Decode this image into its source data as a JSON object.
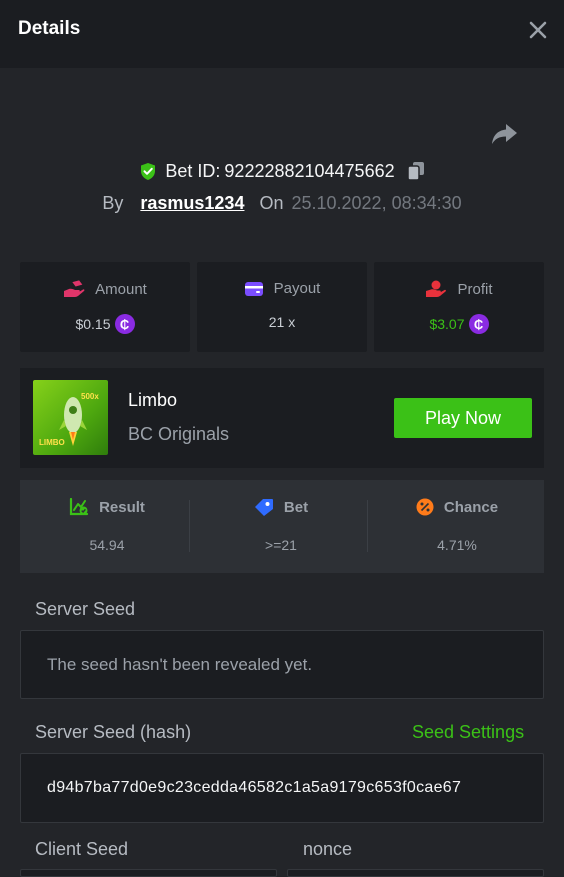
{
  "header": {
    "title": "Details"
  },
  "bet": {
    "id_label": "Bet ID:",
    "id": "92222882104475662",
    "by_label": "By",
    "username": "rasmus1234",
    "on_label": "On",
    "datetime": "25.10.2022, 08:34:30"
  },
  "stats": {
    "amount": {
      "label": "Amount",
      "value": "$0.15"
    },
    "payout": {
      "label": "Payout",
      "value": "21 x"
    },
    "profit": {
      "label": "Profit",
      "value": "$3.07"
    }
  },
  "game": {
    "name": "Limbo",
    "provider": "BC Originals",
    "thumb_text": "LIMBO",
    "thumb_badge": "500x",
    "play_label": "Play Now"
  },
  "result": {
    "result": {
      "label": "Result",
      "value": "54.94"
    },
    "bet": {
      "label": "Bet",
      "value": ">=21"
    },
    "chance": {
      "label": "Chance",
      "value": "4.71%"
    }
  },
  "server_seed": {
    "label": "Server Seed",
    "value": "The seed hasn't been revealed yet."
  },
  "server_seed_hash": {
    "label": "Server Seed (hash)",
    "settings_label": "Seed Settings",
    "value": "d94b7ba77d0e9c23cedda46582c1a5a9179c653f0cae67"
  },
  "client_seed": {
    "label": "Client Seed"
  },
  "nonce": {
    "label": "nonce"
  },
  "colors": {
    "accent_green": "#3bc117",
    "coin_purple": "#8a2be2",
    "amount_icon": "#e0356a",
    "payout_icon": "#7b4dff",
    "profit_icon": "#e8323c",
    "bet_icon": "#2f6bff",
    "chance_icon": "#ff7b1a"
  },
  "icons": {
    "close": "close-icon",
    "share": "share-icon",
    "verified": "shield-check-icon",
    "copy": "copy-icon",
    "amount": "money-hand-icon",
    "payout": "wallet-icon",
    "profit": "profit-hand-icon",
    "coin": "bcd-coin-icon",
    "result": "chart-check-icon",
    "bet": "ticket-icon",
    "chance": "percent-icon"
  }
}
